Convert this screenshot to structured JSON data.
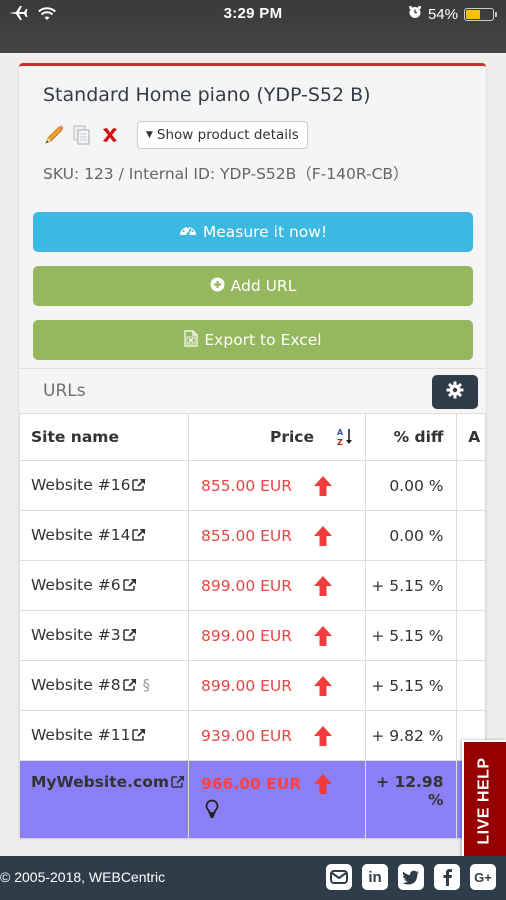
{
  "status_bar": {
    "time": "3:29 PM",
    "battery_percent_label": "54%",
    "battery_level": 0.54
  },
  "product": {
    "title": "Standard Home piano (YDP-S52 B)",
    "show_details_label": "Show product details",
    "sku_line": "SKU: 123 / Internal ID: YDP-S52B（F-140R-CB）"
  },
  "buttons": {
    "measure": "Measure it now!",
    "add_url": "Add URL",
    "export": "Export to Excel"
  },
  "urls_section": {
    "title": "URLs"
  },
  "table": {
    "headers": {
      "site": "Site name",
      "price": "Price",
      "diff": "% diff",
      "extra": "A"
    },
    "rows": [
      {
        "site": "Website #16",
        "price": "855.00  EUR",
        "diff": "0.00 %",
        "paragraph": false
      },
      {
        "site": "Website #14",
        "price": "855.00  EUR",
        "diff": "0.00 %",
        "paragraph": false
      },
      {
        "site": "Website #6",
        "price": "899.00  EUR",
        "diff": "+ 5.15 %",
        "paragraph": false
      },
      {
        "site": "Website #3",
        "price": "899.00  EUR",
        "diff": "+ 5.15 %",
        "paragraph": false
      },
      {
        "site": "Website #8",
        "price": "899.00  EUR",
        "diff": "+ 5.15 %",
        "paragraph": true
      },
      {
        "site": "Website #11",
        "price": "939.00  EUR",
        "diff": "+ 9.82 %",
        "paragraph": false
      }
    ],
    "own_row": {
      "site": "MyWebsite.com",
      "price": "966.00  EUR",
      "diff": "+ 12.98 %"
    }
  },
  "live_help": "LIVE HELP",
  "footer": {
    "copyright": "© 2005-2018, WEBCentric",
    "social": [
      "email-icon",
      "linkedin-icon",
      "twitter-icon",
      "facebook-icon",
      "google-plus-icon"
    ]
  },
  "colors": {
    "accent_red": "#c9302c",
    "measure_blue": "#3db8e3",
    "green": "#95b75d",
    "price_red": "#e84545",
    "own_row_purple": "#8a7ff5",
    "dark_navy": "#2f3d4b",
    "live_help_red": "#960000"
  }
}
